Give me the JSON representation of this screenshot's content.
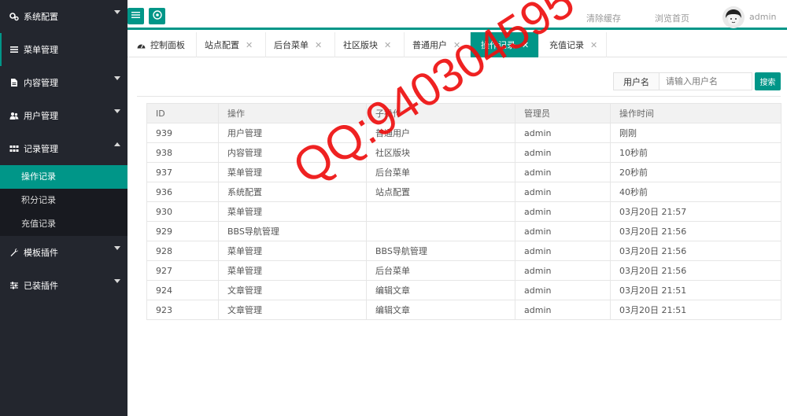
{
  "sidebar": {
    "items": [
      {
        "label": "系统配置",
        "icon": "gears-icon",
        "expanded": false
      },
      {
        "label": "菜单管理",
        "icon": "list-icon",
        "expanded": false
      },
      {
        "label": "内容管理",
        "icon": "file-icon",
        "expanded": false
      },
      {
        "label": "用户管理",
        "icon": "users-icon",
        "expanded": false
      },
      {
        "label": "记录管理",
        "icon": "grid-icon",
        "expanded": true,
        "children": [
          {
            "label": "操作记录",
            "active": true
          },
          {
            "label": "积分记录",
            "active": false
          },
          {
            "label": "充值记录",
            "active": false
          }
        ]
      },
      {
        "label": "模板插件",
        "icon": "wrench-icon",
        "expanded": false
      },
      {
        "label": "已装插件",
        "icon": "sliders-icon",
        "expanded": false
      }
    ]
  },
  "topbar": {
    "clear_cache": "清除缓存",
    "browse_home": "浏览首页",
    "username": "admin"
  },
  "tabs": [
    {
      "label": "控制面板",
      "closable": false,
      "active": false,
      "icon": "dashboard-icon"
    },
    {
      "label": "站点配置",
      "closable": true,
      "active": false
    },
    {
      "label": "后台菜单",
      "closable": true,
      "active": false
    },
    {
      "label": "社区版块",
      "closable": true,
      "active": false
    },
    {
      "label": "普通用户",
      "closable": true,
      "active": false
    },
    {
      "label": "操作记录",
      "closable": true,
      "active": true
    },
    {
      "label": "充值记录",
      "closable": true,
      "active": false
    }
  ],
  "search": {
    "label": "用户名",
    "placeholder": "请输入用户名",
    "button": "搜索"
  },
  "table": {
    "columns": [
      "ID",
      "操作",
      "子操作",
      "管理员",
      "操作时间"
    ],
    "rows": [
      [
        "939",
        "用户管理",
        "普通用户",
        "admin",
        "刚刚"
      ],
      [
        "938",
        "内容管理",
        "社区版块",
        "admin",
        "10秒前"
      ],
      [
        "937",
        "菜单管理",
        "后台菜单",
        "admin",
        "20秒前"
      ],
      [
        "936",
        "系统配置",
        "站点配置",
        "admin",
        "40秒前"
      ],
      [
        "930",
        "菜单管理",
        "",
        "admin",
        "03月20日 21:57"
      ],
      [
        "929",
        "BBS导航管理",
        "",
        "admin",
        "03月20日 21:56"
      ],
      [
        "928",
        "菜单管理",
        "BBS导航管理",
        "admin",
        "03月20日 21:56"
      ],
      [
        "927",
        "菜单管理",
        "后台菜单",
        "admin",
        "03月20日 21:56"
      ],
      [
        "924",
        "文章管理",
        "编辑文章",
        "admin",
        "03月20日 21:51"
      ],
      [
        "923",
        "文章管理",
        "编辑文章",
        "admin",
        "03月20日 21:51"
      ]
    ]
  },
  "watermark": "QQ:940304595",
  "colors": {
    "accent": "#009688",
    "sidebar_bg": "#23262e",
    "watermark": "#ee1010"
  }
}
